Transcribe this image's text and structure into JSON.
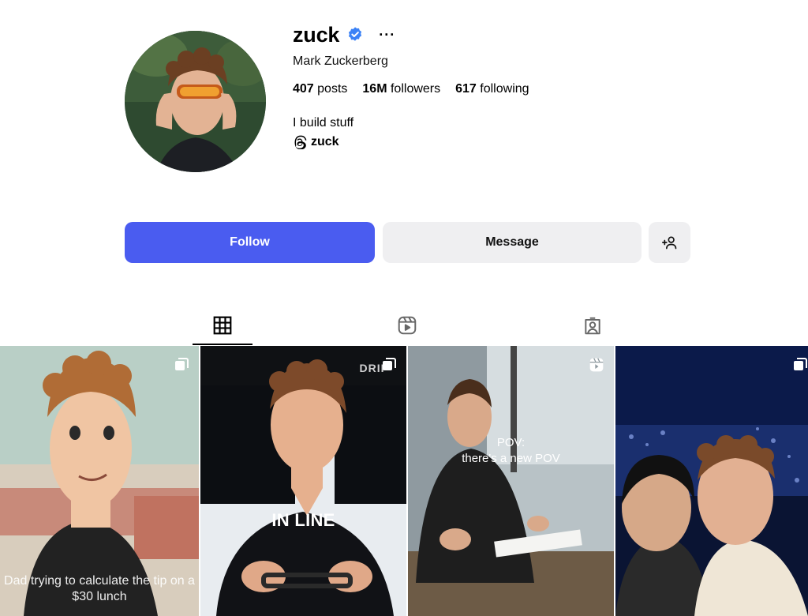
{
  "profile": {
    "username": "zuck",
    "full_name": "Mark Zuckerberg",
    "more_label": "···",
    "bio": "I build stuff",
    "threads_handle": "zuck"
  },
  "stats": [
    {
      "count": "407",
      "label": "posts"
    },
    {
      "count": "16M",
      "label": "followers"
    },
    {
      "count": "617",
      "label": "following"
    }
  ],
  "buttons": {
    "follow": "Follow",
    "message": "Message"
  },
  "tabs": [
    {
      "name": "posts-grid-icon",
      "active": true
    },
    {
      "name": "reels-icon",
      "active": false
    },
    {
      "name": "tagged-icon",
      "active": false
    }
  ],
  "posts": [
    {
      "caption": "Dad trying to calculate the tip on a $30 lunch",
      "type": "carousel"
    },
    {
      "caption": "IN LINE",
      "sign_text": "DRIP",
      "type": "carousel"
    },
    {
      "caption": "POV:\nthere's a new POV",
      "type": "reel"
    },
    {
      "caption": "",
      "type": "carousel"
    }
  ],
  "colors": {
    "follow_button": "#4a5cf0",
    "secondary_button": "#efeff1",
    "verified_badge": "#3b82f6"
  }
}
